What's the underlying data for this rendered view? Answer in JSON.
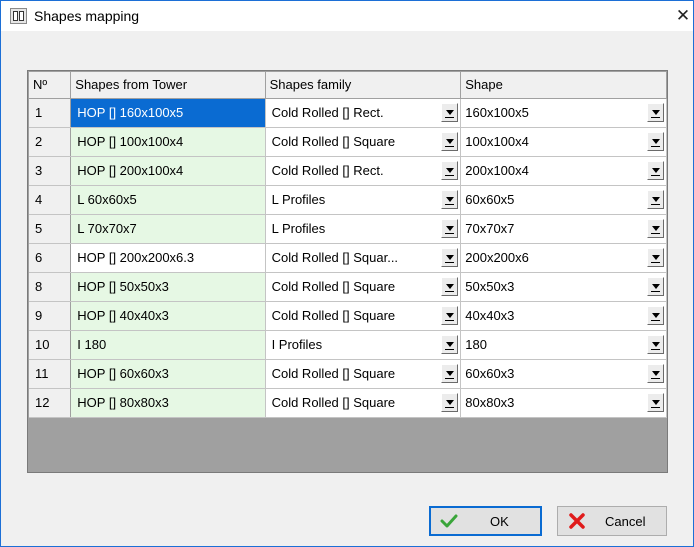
{
  "window": {
    "title": "Shapes mapping",
    "close_label": "✕"
  },
  "grid": {
    "columns": [
      "Nº",
      "Shapes from Tower",
      "Shapes family",
      "Shape"
    ],
    "rows": [
      {
        "num": "1",
        "tower": "HOP [] 160x100x5",
        "family": "Cold Rolled [] Rect.",
        "shape": "160x100x5",
        "state": "selected"
      },
      {
        "num": "2",
        "tower": "HOP [] 100x100x4",
        "family": "Cold Rolled [] Square",
        "shape": "100x100x4",
        "state": "green"
      },
      {
        "num": "3",
        "tower": "HOP [] 200x100x4",
        "family": "Cold Rolled [] Rect.",
        "shape": "200x100x4",
        "state": "green"
      },
      {
        "num": "4",
        "tower": "L 60x60x5",
        "family": "L Profiles",
        "shape": "60x60x5",
        "state": "green"
      },
      {
        "num": "5",
        "tower": "L 70x70x7",
        "family": "L Profiles",
        "shape": "70x70x7",
        "state": "green"
      },
      {
        "num": "6",
        "tower": "HOP [] 200x200x6.3",
        "family": "Cold Rolled [] Squar...",
        "shape": "200x200x6",
        "state": "white"
      },
      {
        "num": "8",
        "tower": "HOP [] 50x50x3",
        "family": "Cold Rolled [] Square",
        "shape": "50x50x3",
        "state": "green"
      },
      {
        "num": "9",
        "tower": "HOP [] 40x40x3",
        "family": "Cold Rolled [] Square",
        "shape": "40x40x3",
        "state": "green"
      },
      {
        "num": "10",
        "tower": "I 180",
        "family": "I Profiles",
        "shape": "180",
        "state": "green"
      },
      {
        "num": "11",
        "tower": "HOP [] 60x60x3",
        "family": "Cold Rolled [] Square",
        "shape": "60x60x3",
        "state": "green"
      },
      {
        "num": "12",
        "tower": "HOP [] 80x80x3",
        "family": "Cold Rolled [] Square",
        "shape": "80x80x3",
        "state": "green"
      }
    ]
  },
  "buttons": {
    "ok_label": "OK",
    "cancel_label": "Cancel",
    "ok_icon": "checkmark-icon",
    "cancel_icon": "red-x-icon"
  },
  "colors": {
    "accent": "#0a6bd2",
    "matched_row": "#e6f8e4",
    "ok_check": "#3aa53a",
    "cancel_x": "#e01b1b"
  }
}
